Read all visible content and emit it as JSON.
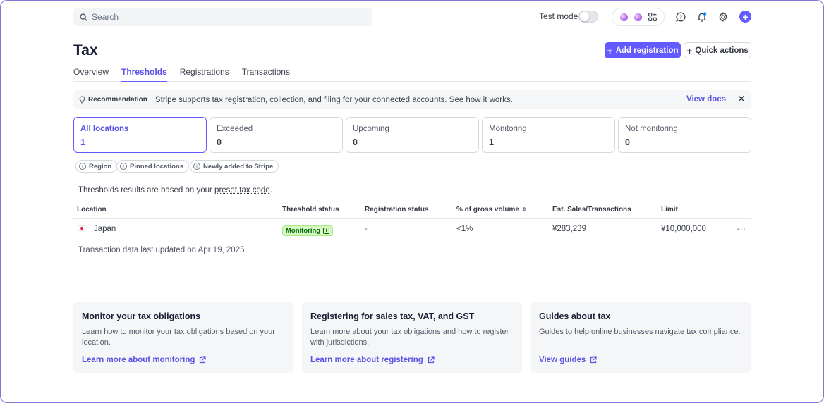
{
  "search": {
    "placeholder": "Search"
  },
  "topbar": {
    "test_mode_label": "Test mode"
  },
  "header": {
    "title": "Tax",
    "add_registration_label": "Add registration",
    "quick_actions_label": "Quick actions"
  },
  "tabs": [
    {
      "label": "Overview",
      "active": false
    },
    {
      "label": "Thresholds",
      "active": true
    },
    {
      "label": "Registrations",
      "active": false
    },
    {
      "label": "Transactions",
      "active": false
    }
  ],
  "banner": {
    "tag": "Recommendation",
    "message": "Stripe supports tax registration, collection, and filing for your connected accounts. See how it works.",
    "link": "View docs"
  },
  "summary_cards": [
    {
      "label": "All locations",
      "value": "1",
      "active": true
    },
    {
      "label": "Exceeded",
      "value": "0",
      "active": false
    },
    {
      "label": "Upcoming",
      "value": "0",
      "active": false
    },
    {
      "label": "Monitoring",
      "value": "1",
      "active": false
    },
    {
      "label": "Not monitoring",
      "value": "0",
      "active": false
    }
  ],
  "filters": [
    "Region",
    "Pinned locations",
    "Newly added to Stripe"
  ],
  "note": {
    "prefix": "Thresholds results are based on your ",
    "link": "preset tax code",
    "suffix": "."
  },
  "table": {
    "headers": [
      "Location",
      "Threshold status",
      "Registration status",
      "% of gross volume",
      "Est. Sales/Transactions",
      "Limit"
    ],
    "rows": [
      {
        "location": "Japan",
        "threshold_status": "Monitoring",
        "registration_status": "-",
        "gross_volume": "<1%",
        "est_sales": "¥283,239",
        "limit": "¥10,000,000",
        "more": "···"
      }
    ],
    "updated": "Transaction data last updated on Apr 19, 2025"
  },
  "resources": [
    {
      "title": "Monitor your tax obligations",
      "body": "Learn how to monitor your tax obligations based on your location.",
      "link": "Learn more about monitoring"
    },
    {
      "title": "Registering for sales tax, VAT, and GST",
      "body": "Learn more about your tax obligations and how to register with jurisdictions.",
      "link": "Learn more about registering"
    },
    {
      "title": "Guides about tax",
      "body": "Guides to help online businesses navigate tax compliance.",
      "link": "View guides"
    }
  ],
  "colors": {
    "accent": "#635bff",
    "status_green_bg": "#d7f7c2",
    "status_green_text": "#006908"
  }
}
